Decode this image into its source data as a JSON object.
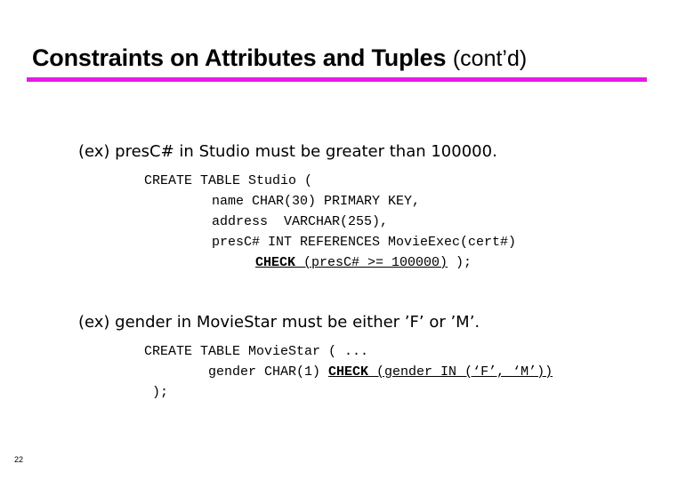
{
  "slide": {
    "title": "Constraints on Attributes and Tuples",
    "title_suffix": "(cont’d)",
    "accent_color": "#e619e6",
    "page_number": "22"
  },
  "example1": {
    "description": "(ex)  presC# in Studio must be greater than 100000.",
    "code": {
      "line1": "CREATE TABLE Studio (",
      "line2": "name CHAR(30) PRIMARY KEY,",
      "line3": "address  VARCHAR(255),",
      "line4": "presC# INT REFERENCES MovieExec(cert#)",
      "check_keyword": "CHECK",
      "check_condition": " (presC# >= 100000)",
      "check_tail": " );"
    }
  },
  "example2": {
    "description": "(ex) gender in MovieStar must be either ’F’ or ’M’.",
    "code": {
      "line1": "CREATE TABLE MovieStar ( ...",
      "line2_prefix": "gender CHAR(1) ",
      "check_keyword": "CHECK",
      "check_condition": " (gender IN (‘F’, ‘M’))",
      "line3": ");"
    }
  }
}
